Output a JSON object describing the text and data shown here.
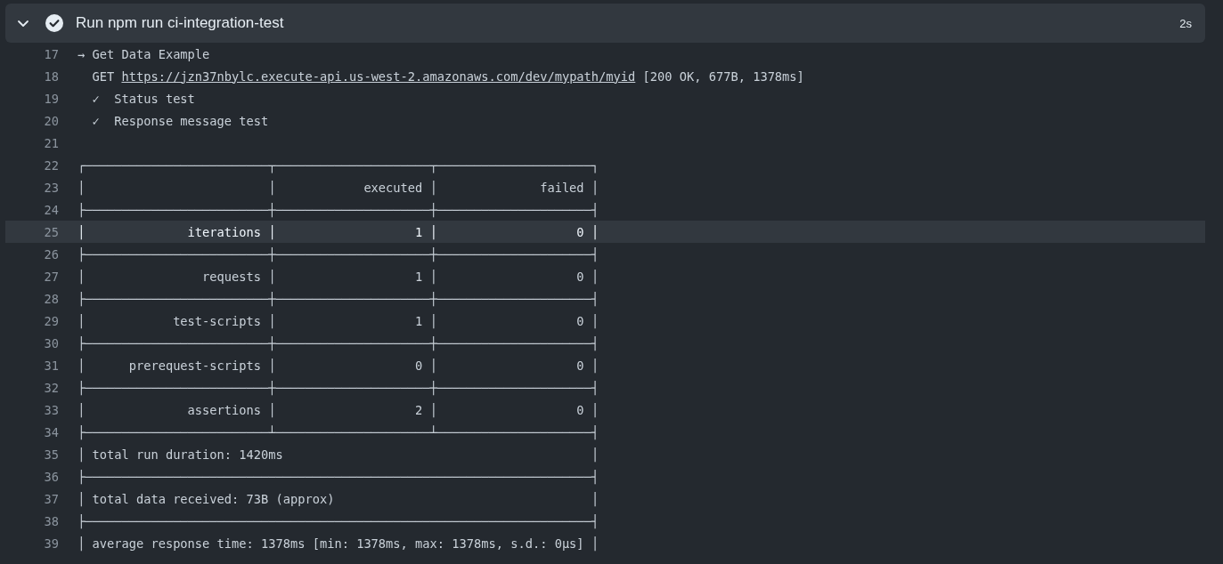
{
  "step": {
    "title": "Run npm run ci-integration-test",
    "duration": "2s",
    "expanded": true,
    "succeeded": true
  },
  "lines": [
    {
      "number": "17",
      "parts": [
        {
          "kind": "text",
          "text": "→ Get Data Example"
        }
      ]
    },
    {
      "number": "18",
      "parts": [
        {
          "kind": "text",
          "text": "  GET "
        },
        {
          "kind": "link",
          "text": "https://jzn37nbylc.execute-api.us-west-2.amazonaws.com/dev/mypath/myid"
        },
        {
          "kind": "text",
          "text": " [200 OK, 677B, 1378ms]"
        }
      ]
    },
    {
      "number": "19",
      "parts": [
        {
          "kind": "text",
          "text": "  ✓  Status test"
        }
      ]
    },
    {
      "number": "20",
      "parts": [
        {
          "kind": "text",
          "text": "  ✓  Response message test"
        }
      ]
    },
    {
      "number": "21"
    },
    {
      "number": "22",
      "parts": [
        {
          "kind": "text",
          "text": "┌─────────────────────────┬─────────────────────┬─────────────────────┐"
        }
      ]
    },
    {
      "number": "23",
      "parts": [
        {
          "kind": "text",
          "text": "│                         │            executed │              failed │"
        }
      ]
    },
    {
      "number": "24",
      "parts": [
        {
          "kind": "text",
          "text": "├─────────────────────────┼─────────────────────┼─────────────────────┤"
        }
      ]
    },
    {
      "number": "25",
      "highlighted": true,
      "parts": [
        {
          "kind": "text",
          "text": "│              iterations │                   1 │                   0 │"
        }
      ]
    },
    {
      "number": "26",
      "parts": [
        {
          "kind": "text",
          "text": "├─────────────────────────┼─────────────────────┼─────────────────────┤"
        }
      ]
    },
    {
      "number": "27",
      "parts": [
        {
          "kind": "text",
          "text": "│                requests │                   1 │                   0 │"
        }
      ]
    },
    {
      "number": "28",
      "parts": [
        {
          "kind": "text",
          "text": "├─────────────────────────┼─────────────────────┼─────────────────────┤"
        }
      ]
    },
    {
      "number": "29",
      "parts": [
        {
          "kind": "text",
          "text": "│            test-scripts │                   1 │                   0 │"
        }
      ]
    },
    {
      "number": "30",
      "parts": [
        {
          "kind": "text",
          "text": "├─────────────────────────┼─────────────────────┼─────────────────────┤"
        }
      ]
    },
    {
      "number": "31",
      "parts": [
        {
          "kind": "text",
          "text": "│      prerequest-scripts │                   0 │                   0 │"
        }
      ]
    },
    {
      "number": "32",
      "parts": [
        {
          "kind": "text",
          "text": "├─────────────────────────┼─────────────────────┼─────────────────────┤"
        }
      ]
    },
    {
      "number": "33",
      "parts": [
        {
          "kind": "text",
          "text": "│              assertions │                   2 │                   0 │"
        }
      ]
    },
    {
      "number": "34",
      "parts": [
        {
          "kind": "text",
          "text": "├─────────────────────────┴─────────────────────┴─────────────────────┤"
        }
      ]
    },
    {
      "number": "35",
      "parts": [
        {
          "kind": "text",
          "text": "│ total run duration: 1420ms                                          │"
        }
      ]
    },
    {
      "number": "36",
      "parts": [
        {
          "kind": "text",
          "text": "├─────────────────────────────────────────────────────────────────────┤"
        }
      ]
    },
    {
      "number": "37",
      "parts": [
        {
          "kind": "text",
          "text": "│ total data received: 73B (approx)                                   │"
        }
      ]
    },
    {
      "number": "38",
      "parts": [
        {
          "kind": "text",
          "text": "├─────────────────────────────────────────────────────────────────────┤"
        }
      ]
    },
    {
      "number": "39",
      "parts": [
        {
          "kind": "text",
          "text": "│ average response time: 1378ms [min: 1378ms, max: 1378ms, s.d.: 0µs] │"
        }
      ]
    }
  ]
}
